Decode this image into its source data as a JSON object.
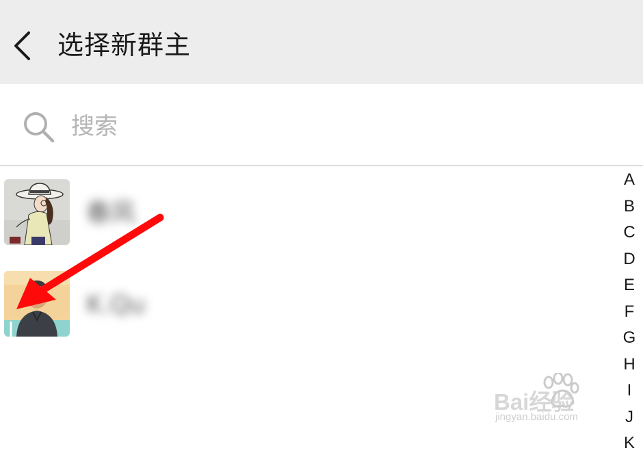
{
  "header": {
    "title": "选择新群主",
    "back_icon": "chevron-left-icon"
  },
  "search": {
    "placeholder": "搜索",
    "value": "",
    "icon": "search-icon"
  },
  "contacts": [
    {
      "name": "春风",
      "avatar": "cartoon-girl-with-hat"
    },
    {
      "name": "K.Qu",
      "avatar": "cartoon-boy-portrait"
    }
  ],
  "alpha_index": [
    "A",
    "B",
    "C",
    "D",
    "E",
    "F",
    "G",
    "H",
    "I",
    "J",
    "K"
  ],
  "annotation": {
    "arrow_color": "#ff0a0a",
    "points_to": "second-contact-avatar"
  },
  "watermark": {
    "brand": "Bai经验",
    "url": "jingyan.baidu.com"
  },
  "colors": {
    "header_bg": "#ededed",
    "divider": "#dcdcdc",
    "placeholder": "#b5b5b5"
  }
}
